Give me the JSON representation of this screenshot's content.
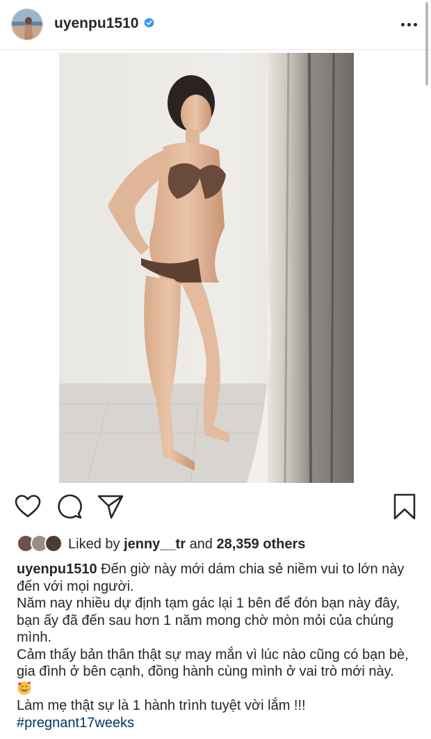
{
  "post": {
    "username": "uyenpu1510",
    "verified_icon": "verified-badge-icon",
    "more_icon": "more-options-icon"
  },
  "photo": {
    "description_icon": "post-photo"
  },
  "actions": {
    "like_icon": "heart-icon",
    "comment_icon": "comment-icon",
    "share_icon": "send-icon",
    "save_icon": "bookmark-icon"
  },
  "likes": {
    "prefix": "Liked by",
    "user": "jenny__tr",
    "conjunction": "and",
    "others": "28,359 others"
  },
  "caption": {
    "username": "uyenpu1510",
    "line1": "Đến giờ này mới dám chia sẻ niềm vui to lớn này đến với mọi người.",
    "line2": "Năm nay nhiều dự định tạm gác lại 1 bên để đón bạn này đây, bạn ấy đã đến sau hơn 1 năm mong chờ mòn mỏi của chúng mình.",
    "line3": "Cảm thấy bản thân thật sự may mắn vì lúc nào cũng có bạn bè, gia đình ở bên cạnh, đồng hành cùng mình ở vai trò mới này.",
    "line4": "Làm mẹ thật sự là 1 hành trình tuyệt vời lắm !!!",
    "hashtag": "#pregnant17weeks"
  },
  "colors": {
    "text": "#262626",
    "hashtag": "#003569",
    "verified": "#3897f0",
    "divider": "#e6e6e6"
  }
}
